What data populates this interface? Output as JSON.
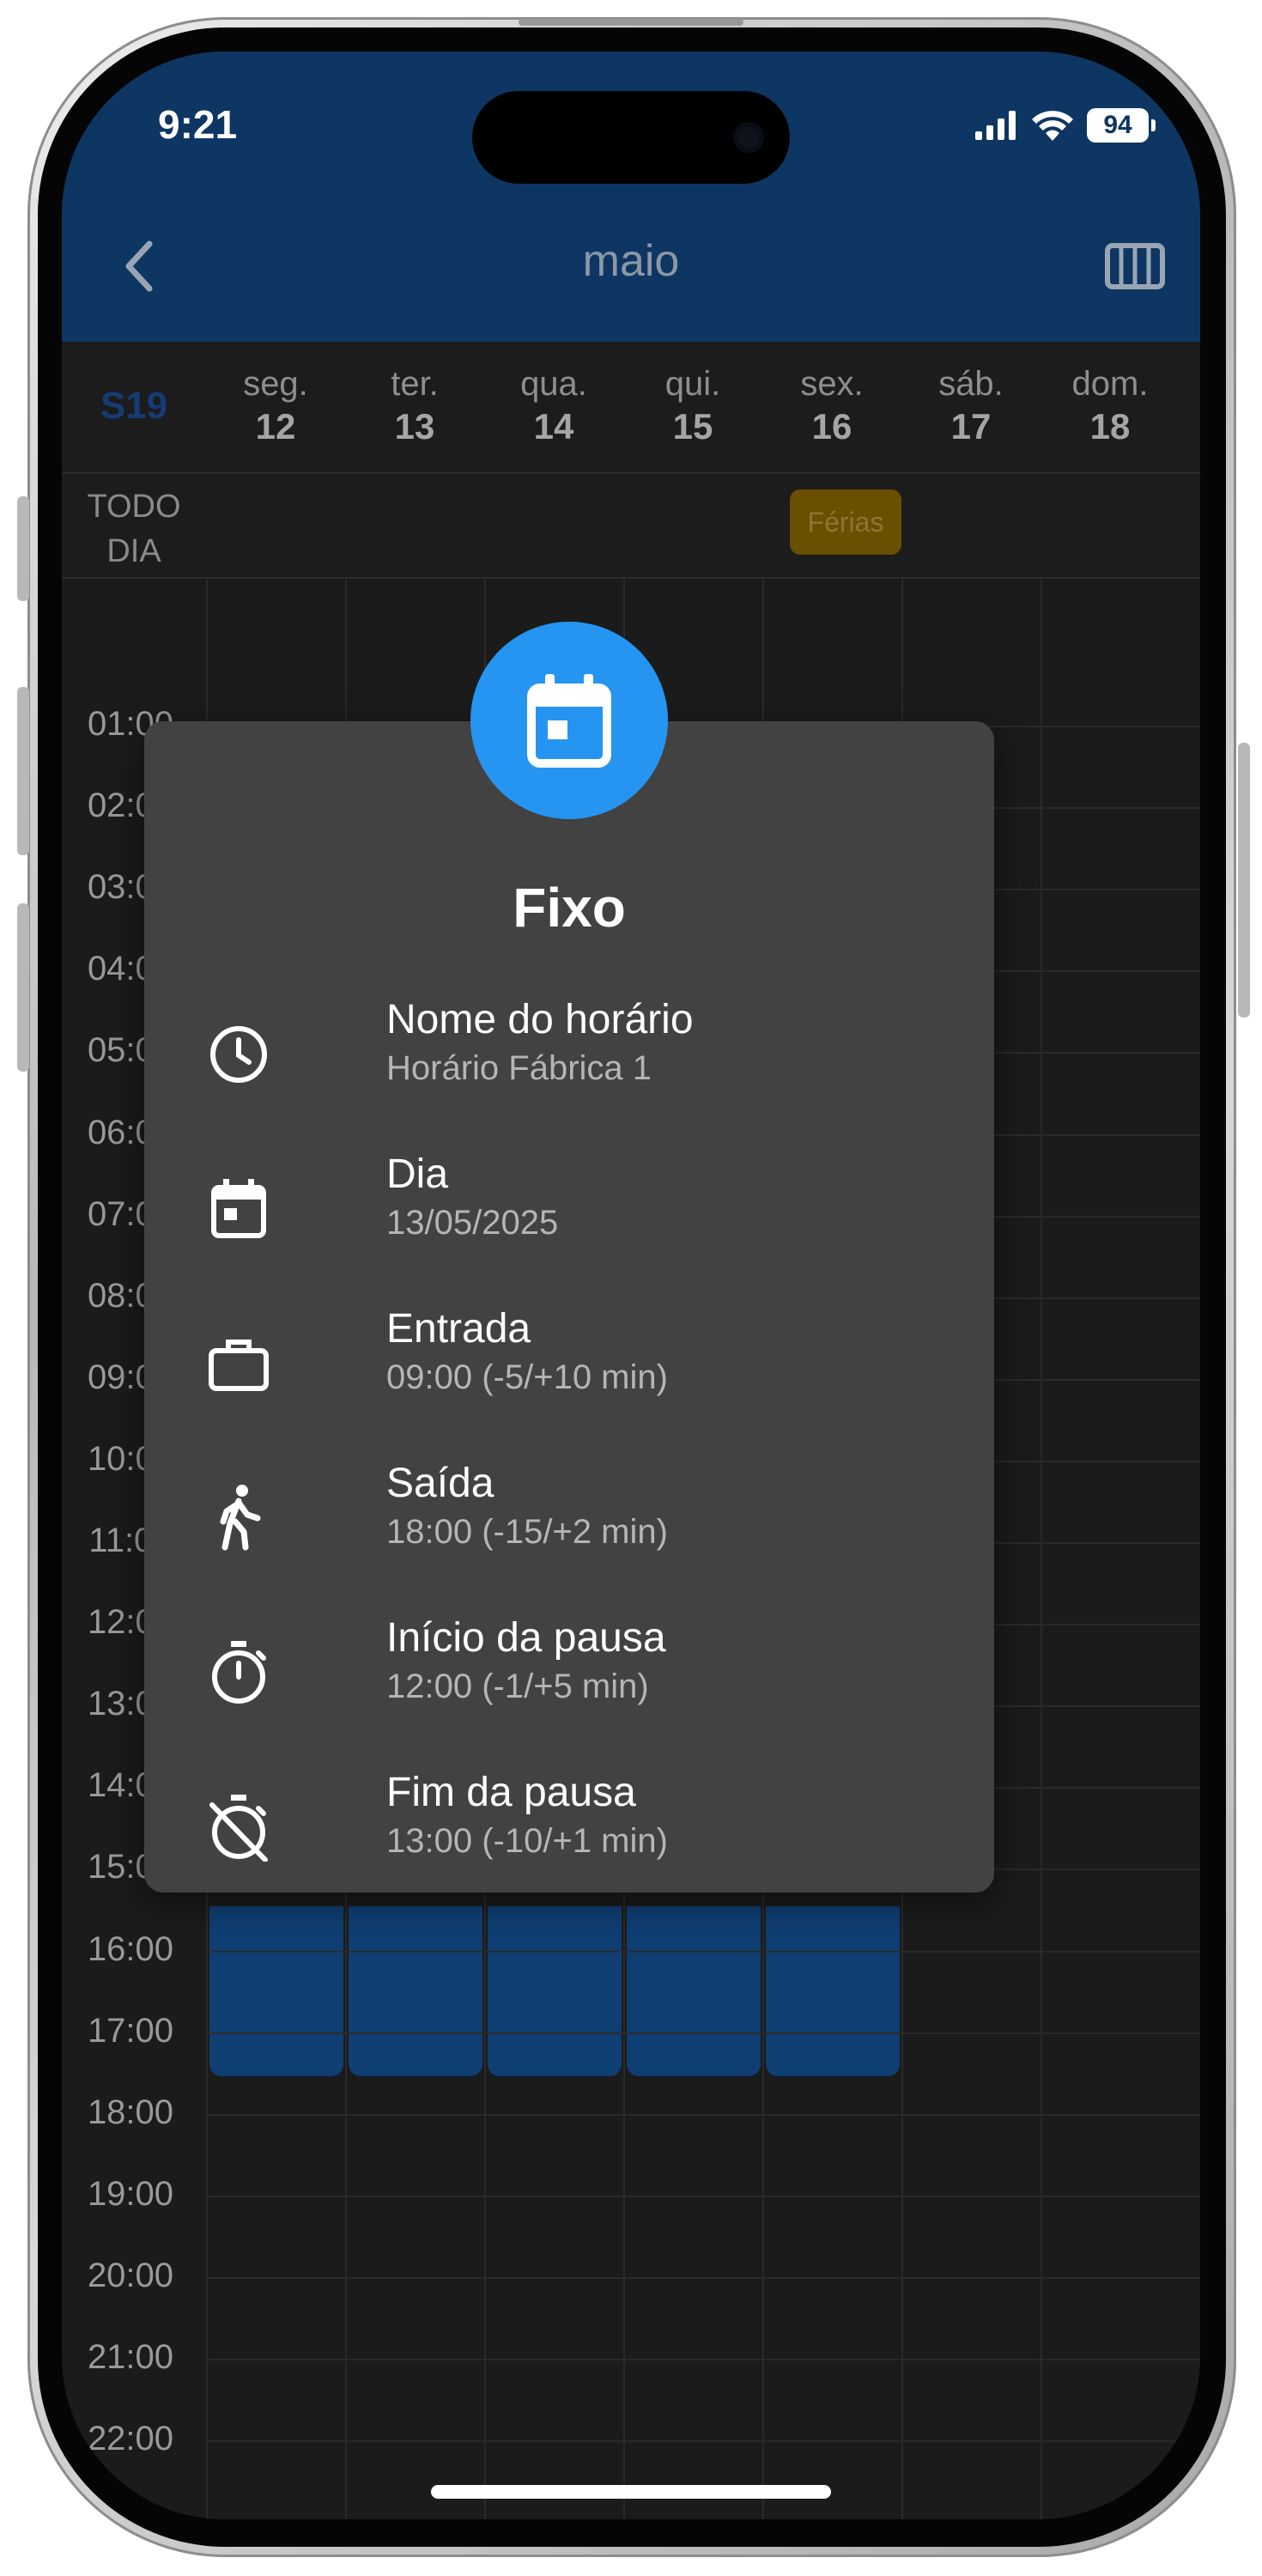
{
  "status_bar": {
    "time": "9:21",
    "battery": "94",
    "icons": [
      "signal-icon",
      "wifi-icon",
      "battery-icon"
    ]
  },
  "header": {
    "month": "maio",
    "back_icon": "chevron-left-icon",
    "view_icon": "view-columns-icon",
    "color": "#0d3663"
  },
  "week": {
    "label": "S19",
    "days": [
      {
        "name": "seg.",
        "num": "12"
      },
      {
        "name": "ter.",
        "num": "13"
      },
      {
        "name": "qua.",
        "num": "14"
      },
      {
        "name": "qui.",
        "num": "15"
      },
      {
        "name": "sex.",
        "num": "16"
      },
      {
        "name": "sáb.",
        "num": "17"
      },
      {
        "name": "dom.",
        "num": "18"
      }
    ]
  },
  "all_day": {
    "label_line1": "TODO",
    "label_line2": "DIA",
    "event": "Férias",
    "event_day": "sex. 16",
    "event_color": "#6b4f00"
  },
  "hours": [
    "01:00",
    "02:00",
    "03:00",
    "04:00",
    "05:00",
    "06:00",
    "07:00",
    "08:00",
    "09:00",
    "10:00",
    "11:00",
    "12:00",
    "13:00",
    "14:00",
    "15:00",
    "16:00",
    "17:00",
    "18:00",
    "19:00",
    "20:00",
    "21:00",
    "22:00"
  ],
  "schedule_event_color": "#0f3e73",
  "modal": {
    "badge_icon": "calendar-icon",
    "badge_color": "#2595f1",
    "title": "Fixo",
    "details": [
      {
        "label": "Nome do horário",
        "value": "Horário Fábrica 1",
        "icon": "clock-icon"
      },
      {
        "label": "Dia",
        "value": "13/05/2025",
        "icon": "calendar-icon"
      },
      {
        "label": "Entrada",
        "value": "09:00 (-5/+10 min)",
        "icon": "briefcase-icon"
      },
      {
        "label": "Saída",
        "value": "18:00 (-15/+2 min)",
        "icon": "walking-icon"
      },
      {
        "label": "Início da pausa",
        "value": "12:00 (-1/+5 min)",
        "icon": "timer-icon"
      },
      {
        "label": "Fim da pausa",
        "value": "13:00 (-10/+1 min)",
        "icon": "timer-off-icon"
      }
    ]
  }
}
